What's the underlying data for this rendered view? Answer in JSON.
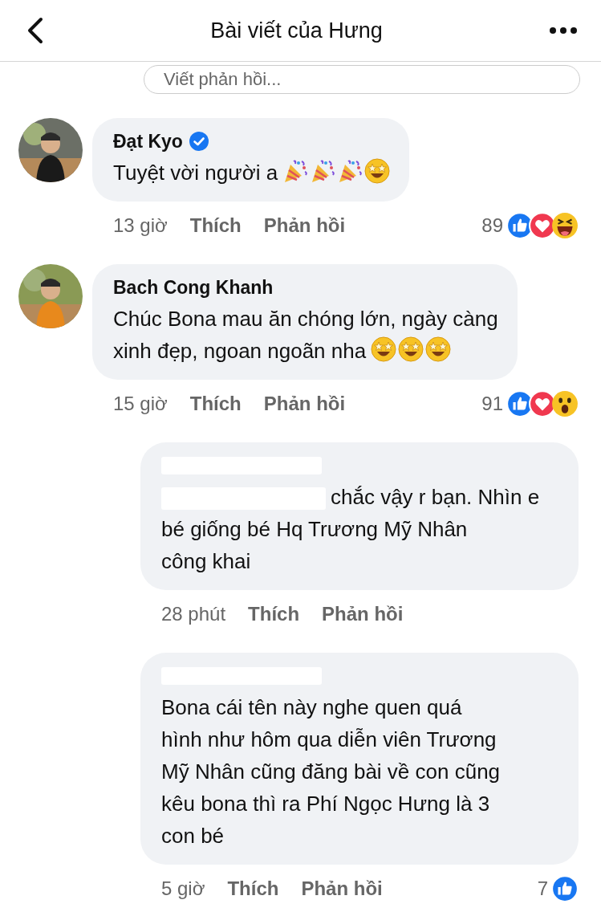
{
  "header": {
    "title": "Bài viết của Hưng"
  },
  "reply_field": {
    "placeholder": "Viết phản hồi..."
  },
  "comments": [
    {
      "kind": "comment",
      "author": "Đạt Kyo",
      "verified": true,
      "lines": [
        "Tuyệt vời người a"
      ],
      "emojis": [
        {
          "kind": "party"
        },
        {
          "kind": "party"
        },
        {
          "kind": "party"
        },
        {
          "kind": "starstruck"
        }
      ],
      "time": "13 giờ",
      "like": "Thích",
      "reply": "Phản hồi",
      "count": "89",
      "reactions": [
        {
          "kind": "like"
        },
        {
          "kind": "love"
        },
        {
          "kind": "haha"
        }
      ]
    },
    {
      "kind": "comment",
      "author": "Bach Cong Khanh",
      "verified": false,
      "lines": [
        "Chúc Bona mau ăn chóng lớn, ngày càng",
        "xinh đẹp, ngoan ngoãn nha"
      ],
      "emojis": [
        {
          "kind": "starstruck"
        },
        {
          "kind": "starstruck"
        },
        {
          "kind": "starstruck"
        }
      ],
      "time": "15 giờ",
      "like": "Thích",
      "reply": "Phản hồi",
      "count": "91",
      "reactions": [
        {
          "kind": "like"
        },
        {
          "kind": "love"
        },
        {
          "kind": "wow"
        }
      ]
    },
    {
      "kind": "reply",
      "mention_redacted": true,
      "lines": [
        "chắc vậy r bạn. Nhìn e",
        "bé giống bé Hq Trương Mỹ Nhân",
        "công khai"
      ],
      "time": "28 phút",
      "like": "Thích",
      "reply": "Phản hồi"
    },
    {
      "kind": "reply",
      "mention_redacted": false,
      "lines": [
        "Bona cái tên này nghe quen quá",
        "hình như hôm qua diễn viên Trương",
        "Mỹ Nhân cũng đăng bài về con cũng",
        "kêu bona thì ra Phí Ngọc Hưng là 3",
        "con bé"
      ],
      "time": "5 giờ",
      "like": "Thích",
      "reply": "Phản hồi",
      "count": "7",
      "reactions": [
        {
          "kind": "like"
        }
      ]
    }
  ]
}
